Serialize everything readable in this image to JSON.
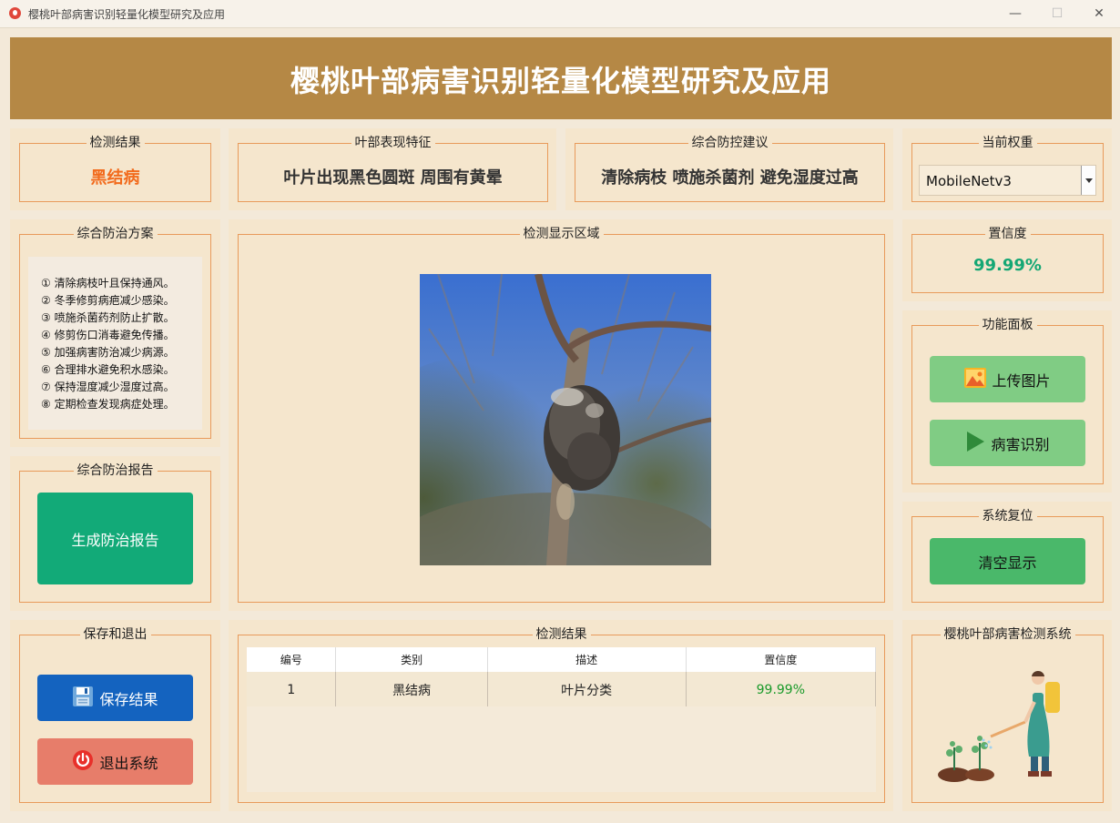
{
  "window": {
    "title": "樱桃叶部病害识别轻量化模型研究及应用",
    "minimize": "—",
    "maximize": "☐",
    "close": "✕"
  },
  "banner": {
    "title": "樱桃叶部病害识别轻量化模型研究及应用"
  },
  "detection_result": {
    "label": "检测结果",
    "value": "黑结病",
    "color": "#f26b1d"
  },
  "leaf_features": {
    "label": "叶部表现特征",
    "value": "叶片出现黑色圆斑 周围有黄晕"
  },
  "control_advice": {
    "label": "综合防控建议",
    "value": "清除病枝 喷施杀菌剂 避免湿度过高"
  },
  "weights": {
    "label": "当前权重",
    "selected": "MobileNetv3"
  },
  "plan": {
    "label": "综合防治方案",
    "items": [
      "① 清除病枝叶且保持通风。",
      "② 冬季修剪病疤减少感染。",
      "③ 喷施杀菌药剂防止扩散。",
      "④ 修剪伤口消毒避免传播。",
      "⑤ 加强病害防治减少病源。",
      "⑥ 合理排水避免积水感染。",
      "⑦ 保持湿度减少湿度过高。",
      "⑧ 定期检查发现病症处理。"
    ]
  },
  "display_area": {
    "label": "检测显示区域"
  },
  "confidence": {
    "label": "置信度",
    "value": "99.99%",
    "color": "#14a774"
  },
  "function_panel": {
    "label": "功能面板",
    "upload": "上传图片",
    "identify": "病害识别"
  },
  "report": {
    "label": "综合防治报告",
    "button": "生成防治报告"
  },
  "reset": {
    "label": "系统复位",
    "button": "清空显示"
  },
  "save_exit": {
    "label": "保存和退出",
    "save": "保存结果",
    "exit": "退出系统"
  },
  "results_table": {
    "label": "检测结果",
    "headers": [
      "编号",
      "类别",
      "描述",
      "置信度"
    ],
    "rows": [
      {
        "id": "1",
        "category": "黑结病",
        "desc": "叶片分类",
        "conf": "99.99%"
      }
    ]
  },
  "system_card": {
    "label": "樱桃叶部病害检测系统"
  },
  "colors": {
    "banner": "#b58845",
    "report_btn": "#12aa78",
    "green_btn": "#80cc84",
    "reset_btn": "#4ab86a",
    "save_btn": "#1463bf",
    "exit_btn": "#e77d6a"
  }
}
